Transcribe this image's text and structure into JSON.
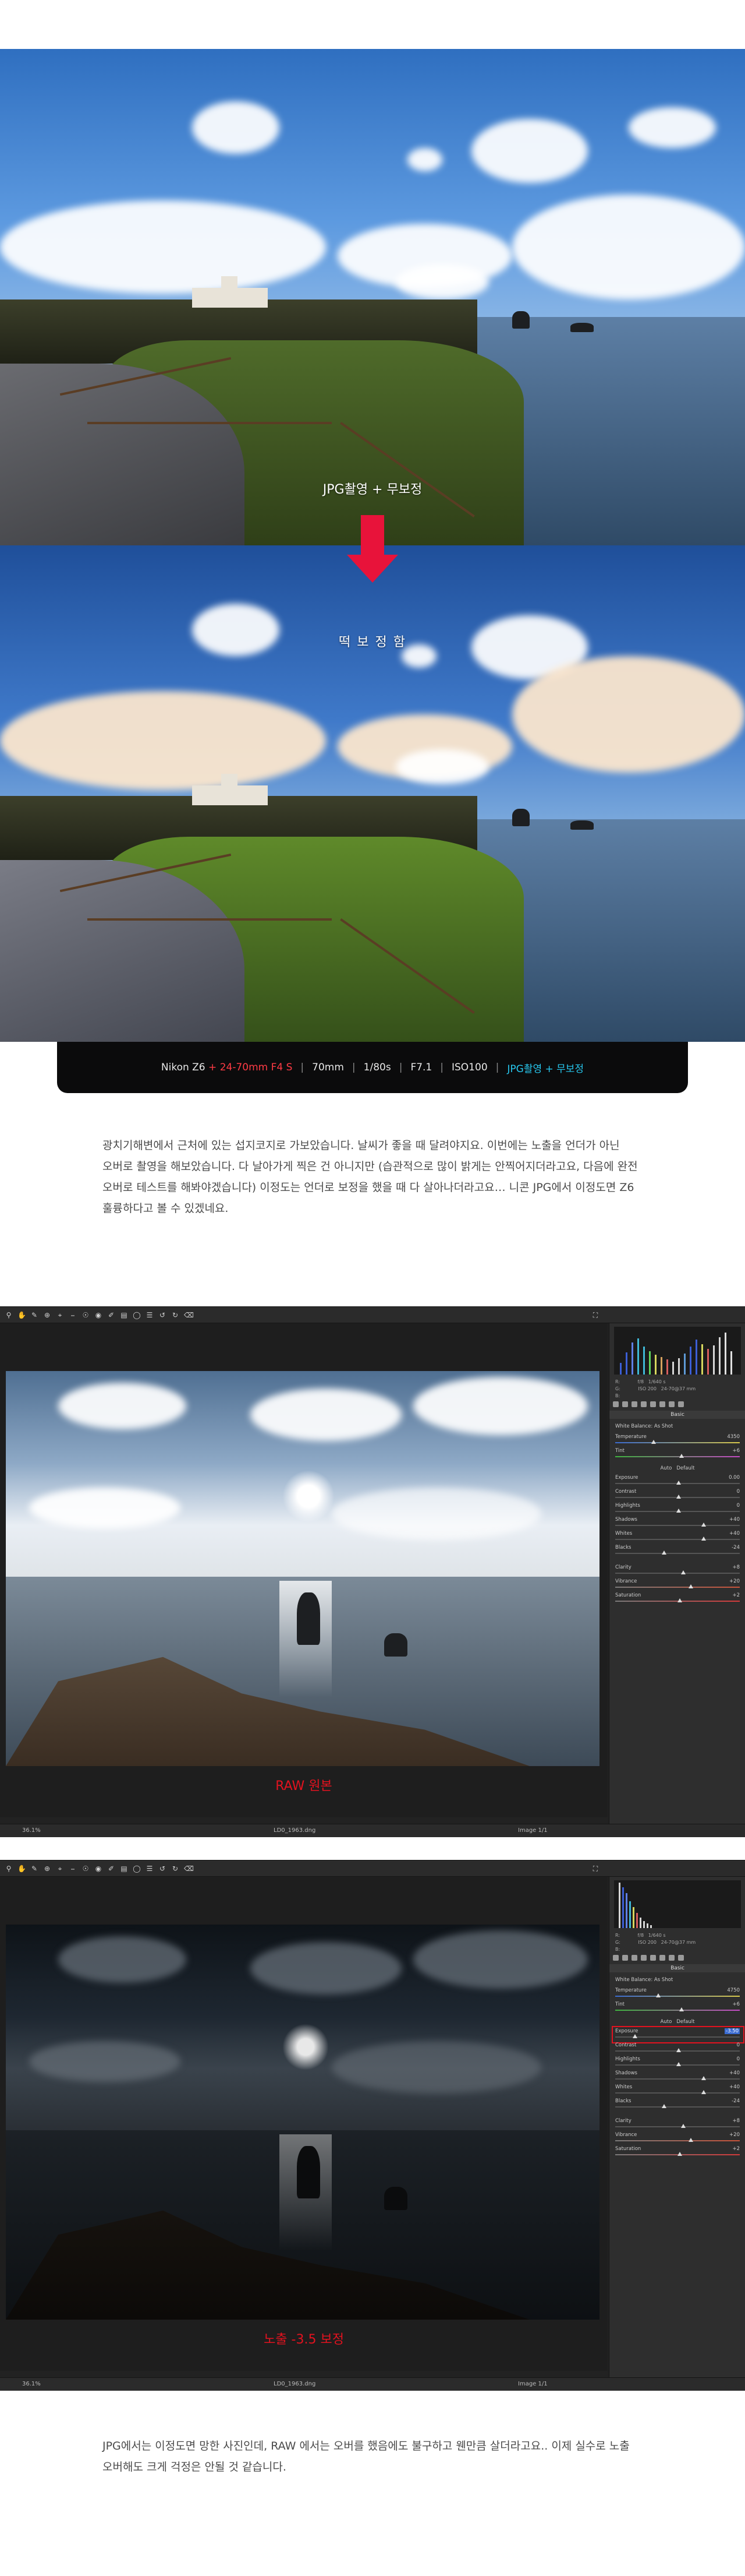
{
  "section1": {
    "caption_top": "JPG촬영 + 무보정",
    "caption_bottom": "떡 보 정 함"
  },
  "specbar": {
    "camera": "Nikon Z6",
    "plus": "+",
    "lens": "24-70mm F4 S",
    "focal": "70mm",
    "shutter": "1/80s",
    "aperture": "F7.1",
    "iso": "ISO100",
    "mode": "JPG촬영 + 무보정",
    "sep": "|"
  },
  "paragraph1": {
    "lines": [
      "광치기해변에서 근처에 있는 섭지코지로 가보았습니다. 날씨가 좋을 때 달려야지요. 이번에는 노출을 언더가 아닌",
      "오버로 촬영을 해보았습니다. 다 날아가게 찍은 건 아니지만 (습관적으로 많이 밝게는 안찍어지더라고요, 다음에 완전",
      "오버로 테스트를 해봐야겠습니다) 이정도는 언더로 보정을 했을 때 다 살아나더라고요… 니콘 JPG에서 이정도면 Z6",
      "훌륭하다고 볼 수 있겠네요."
    ]
  },
  "editor1": {
    "label": "RAW 원본",
    "status_left": "36.1%",
    "filename": "LD0_1963.dng",
    "status_right": "Image 1/1",
    "meta": {
      "a": "R:",
      "b": "G:",
      "c": "B:",
      "d": "f/8",
      "e": "1/640 s",
      "f": "ISO 200",
      "g": "24-70@37 mm"
    },
    "panel_title": "Basic",
    "wb_label": "White Balance:",
    "wb_value": "As Shot",
    "auto": "Auto",
    "default": "Default",
    "rows": [
      {
        "label": "Temperature",
        "value": "4350"
      },
      {
        "label": "Tint",
        "value": "+6"
      },
      {
        "label": "Exposure",
        "value": "0.00"
      },
      {
        "label": "Contrast",
        "value": "0"
      },
      {
        "label": "Highlights",
        "value": "0"
      },
      {
        "label": "Shadows",
        "value": "+40"
      },
      {
        "label": "Whites",
        "value": "+40"
      },
      {
        "label": "Blacks",
        "value": "-24"
      },
      {
        "label": "Clarity",
        "value": "+8"
      },
      {
        "label": "Vibrance",
        "value": "+20"
      },
      {
        "label": "Saturation",
        "value": "+2"
      }
    ]
  },
  "editor2": {
    "label": "노출 -3.5 보정",
    "status_left": "36.1%",
    "filename": "LD0_1963.dng",
    "status_right": "Image 1/1",
    "meta": {
      "a": "R:",
      "b": "G:",
      "c": "B:",
      "d": "f/8",
      "e": "1/640 s",
      "f": "ISO 200",
      "g": "24-70@37 mm"
    },
    "panel_title": "Basic",
    "wb_label": "White Balance:",
    "wb_value": "As Shot",
    "auto": "Auto",
    "default": "Default",
    "rows": [
      {
        "label": "Temperature",
        "value": "4750"
      },
      {
        "label": "Tint",
        "value": "+6"
      },
      {
        "label": "Exposure",
        "value": "-3.50"
      },
      {
        "label": "Contrast",
        "value": "0"
      },
      {
        "label": "Highlights",
        "value": "0"
      },
      {
        "label": "Shadows",
        "value": "+40"
      },
      {
        "label": "Whites",
        "value": "+40"
      },
      {
        "label": "Blacks",
        "value": "-24"
      },
      {
        "label": "Clarity",
        "value": "+8"
      },
      {
        "label": "Vibrance",
        "value": "+20"
      },
      {
        "label": "Saturation",
        "value": "+2"
      }
    ]
  },
  "paragraph2": {
    "lines": [
      "JPG에서는 이정도면 망한 사진인데, RAW 에서는 오버를 했음에도 불구하고 웬만큼 살더라고요.. 이제 실수로 노출",
      "오버해도 크게 걱정은 안될 것 같습니다."
    ]
  },
  "colors": {
    "accent_red": "#e8133a",
    "accent_cyan": "#27c7ee",
    "label_red": "#e3121f"
  },
  "icons": [
    "zoom-icon",
    "hand-icon",
    "eyedropper-icon",
    "target-icon",
    "crop-icon",
    "straighten-icon",
    "spot-removal-icon",
    "redeye-icon",
    "brush-icon",
    "graduated-filter-icon",
    "radial-filter-icon",
    "preferences-icon",
    "rotate-ccw-icon",
    "rotate-cw-icon",
    "trash-icon",
    "fullscreen-icon"
  ]
}
